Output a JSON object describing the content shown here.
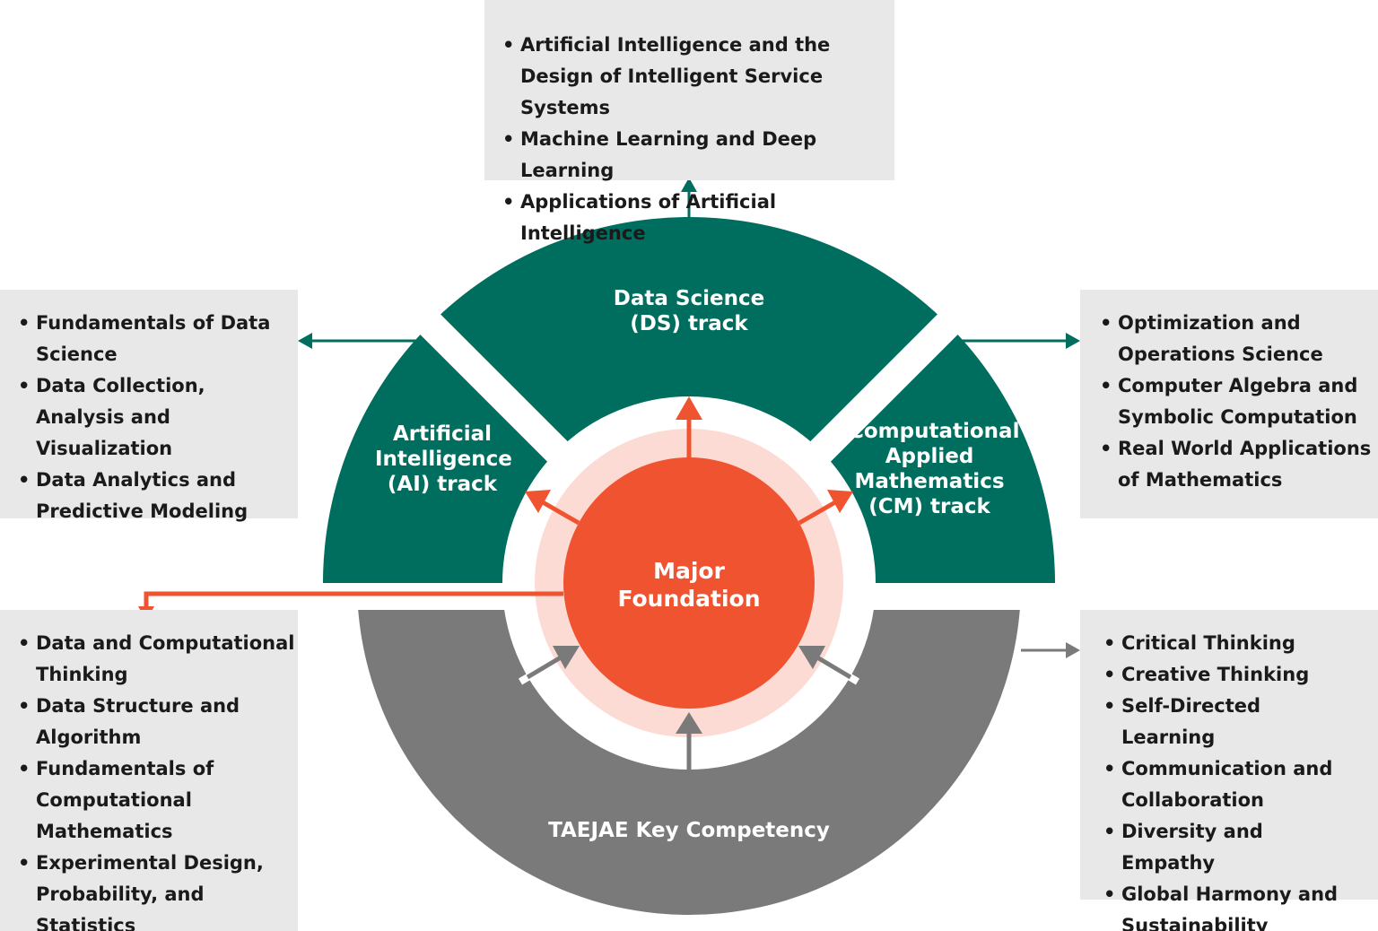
{
  "colors": {
    "track": "#006e5f",
    "foundation": "#f05330",
    "foundation_ring": "#fddbd5",
    "competency": "#7a7a7a",
    "box": "#e8e8e8"
  },
  "tracks": {
    "ds": {
      "label": "Data Science (DS) track",
      "items": [
        "Artificial Intelligence and the Design of Intelligent Service Systems",
        "Machine Learning and Deep Learning",
        "Applications of Artificial Intelligence"
      ]
    },
    "ai": {
      "label": "Artificial Intelligence (AI) track",
      "items": [
        "Fundamentals of Data Science",
        "Data Collection, Analysis and Visualization",
        "Data Analytics and Predictive Modeling"
      ]
    },
    "cm": {
      "label": "Computational Applied Mathematics (CM) track",
      "items": [
        "Optimization and Operations Science",
        "Computer Algebra and Symbolic Computation",
        "Real World Applications of Mathematics"
      ]
    }
  },
  "foundation": {
    "label": "Major Foundation",
    "items": [
      "Data and Computational Thinking",
      "Data Structure and Algorithm",
      "Fundamentals of Computational Mathematics",
      "Experimental Design, Probability, and Statistics"
    ]
  },
  "competency": {
    "label": "TAEJAE Key Competency",
    "items": [
      "Critical Thinking",
      "Creative Thinking",
      "Self-Directed Learning",
      "Communication and Collaboration",
      "Diversity and Empathy",
      "Global Harmony and Sustainability"
    ]
  }
}
